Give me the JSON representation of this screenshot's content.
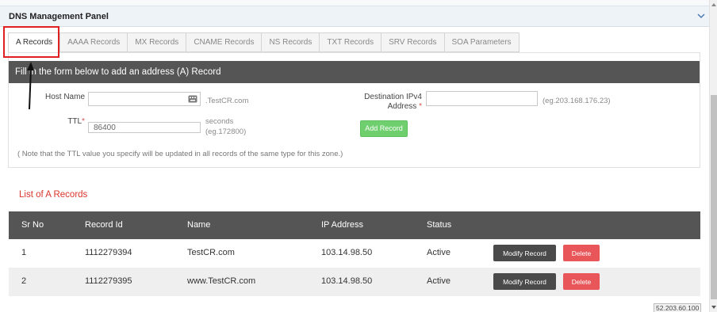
{
  "panel": {
    "title": "DNS Management Panel"
  },
  "tabs": [
    {
      "label": "A Records",
      "active": true
    },
    {
      "label": "AAAA Records",
      "active": false
    },
    {
      "label": "MX Records",
      "active": false
    },
    {
      "label": "CNAME Records",
      "active": false
    },
    {
      "label": "NS Records",
      "active": false
    },
    {
      "label": "TXT Records",
      "active": false
    },
    {
      "label": "SRV Records",
      "active": false
    },
    {
      "label": "SOA Parameters",
      "active": false
    }
  ],
  "form": {
    "header": "Fill in the form below to add an address (A) Record",
    "host_name_label": "Host Name",
    "host_name_value": "",
    "host_suffix": ".TestCR.com",
    "ttl_label": "TTL",
    "required_mark": "*",
    "ttl_value": "86400",
    "ttl_unit": "seconds",
    "ttl_example": "(eg.172800)",
    "dest_label_line1": "Destination IPv4",
    "dest_label_line2": "Address",
    "dest_value": "",
    "dest_example": "(eg.203.168.176.23)",
    "add_button": "Add Record",
    "note": "( Note that the TTL value you specify will be updated in all records of the same type for this zone.)"
  },
  "list": {
    "title": "List of A Records",
    "columns": [
      "Sr No",
      "Record Id",
      "Name",
      "IP Address",
      "Status"
    ],
    "rows": [
      {
        "sr": "1",
        "id": "1112279394",
        "name": "TestCR.com",
        "ip": "103.14.98.50",
        "status": "Active",
        "modify": "Modify Record",
        "delete": "Delete"
      },
      {
        "sr": "2",
        "id": "1112279395",
        "name": "www.TestCR.com",
        "ip": "103.14.98.50",
        "status": "Active",
        "modify": "Modify Record",
        "delete": "Delete"
      }
    ]
  },
  "footer": {
    "ip_badge": "52.203.60.100"
  },
  "colors": {
    "header_bg": "#555555",
    "add_green": "#6fcf6f",
    "delete_red": "#e9565a",
    "title_red": "#d9342b",
    "highlight_red": "#e02020"
  },
  "icons": {
    "chevron": "chevron-down-icon",
    "keyboard": "keyboard-icon",
    "arrow": "annotation-arrow-icon"
  }
}
